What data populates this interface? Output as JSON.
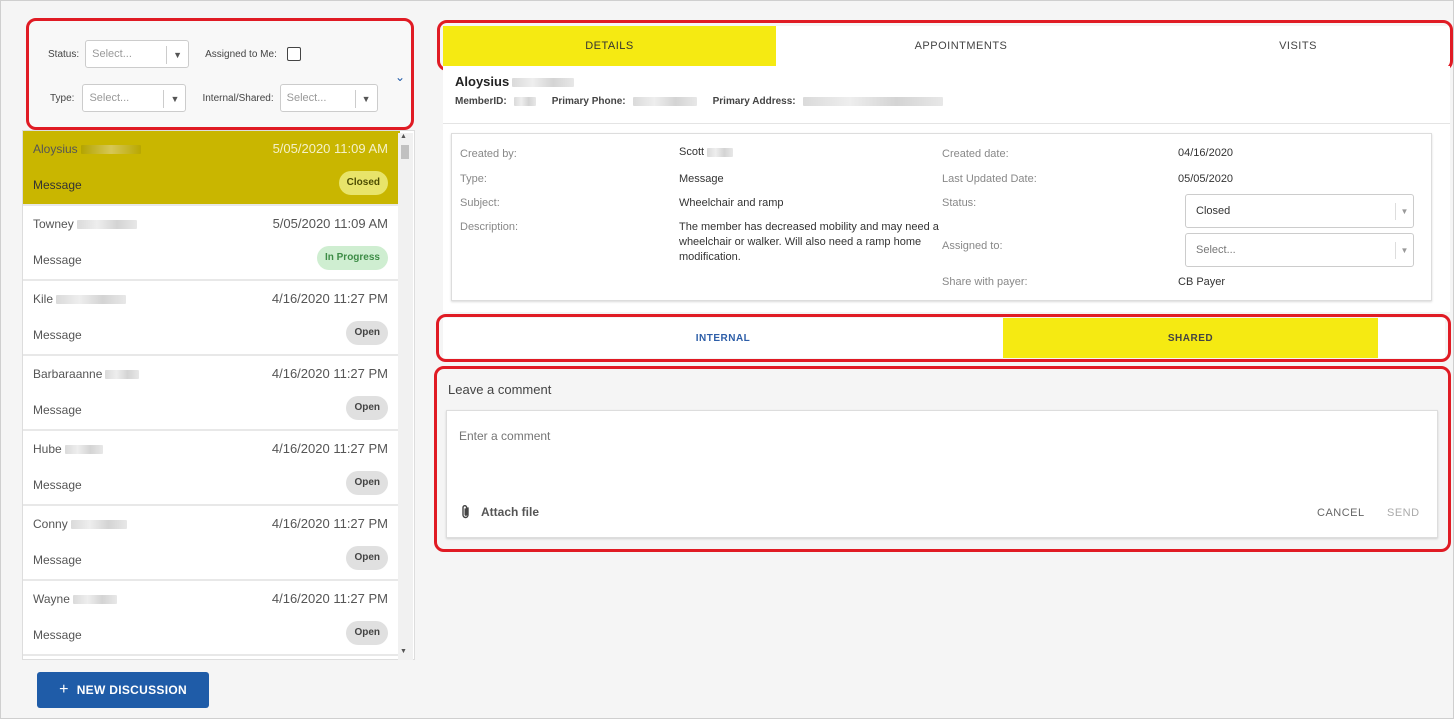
{
  "filters": {
    "status_label": "Status:",
    "status_placeholder": "Select...",
    "assigned_label": "Assigned to Me:",
    "type_label": "Type:",
    "type_placeholder": "Select...",
    "internal_label": "Internal/Shared:",
    "internal_placeholder": "Select..."
  },
  "discussions": [
    {
      "name": "Aloysius",
      "date": "5/05/2020 11:09 AM",
      "type": "Message",
      "status": "Closed"
    },
    {
      "name": "Towney",
      "date": "5/05/2020 11:09 AM",
      "type": "Message",
      "status": "In Progress"
    },
    {
      "name": "Kile",
      "date": "4/16/2020 11:27 PM",
      "type": "Message",
      "status": "Open"
    },
    {
      "name": "Barbaraanne",
      "date": "4/16/2020 11:27 PM",
      "type": "Message",
      "status": "Open"
    },
    {
      "name": "Hube",
      "date": "4/16/2020 11:27 PM",
      "type": "Message",
      "status": "Open"
    },
    {
      "name": "Conny",
      "date": "4/16/2020 11:27 PM",
      "type": "Message",
      "status": "Open"
    },
    {
      "name": "Wayne",
      "date": "4/16/2020 11:27 PM",
      "type": "Message",
      "status": "Open"
    }
  ],
  "new_discussion_label": "NEW DISCUSSION",
  "tabs": {
    "details": "DETAILS",
    "appointments": "APPOINTMENTS",
    "visits": "VISITS"
  },
  "member": {
    "name": "Aloysius",
    "member_id_label": "MemberID:",
    "phone_label": "Primary Phone:",
    "address_label": "Primary Address:"
  },
  "details": {
    "created_by_label": "Created by:",
    "created_by": "Scott",
    "type_label": "Type:",
    "type": "Message",
    "subject_label": "Subject:",
    "subject": "Wheelchair and ramp",
    "description_label": "Description:",
    "description": "The member has decreased mobility and may need a wheelchair or walker. Will also need a ramp home modification.",
    "created_date_label": "Created date:",
    "created_date": "04/16/2020",
    "updated_label": "Last Updated Date:",
    "updated_date": "05/05/2020",
    "status_label": "Status:",
    "status": "Closed",
    "assigned_label": "Assigned to:",
    "assigned": "Select...",
    "share_label": "Share with payer:",
    "share": "CB Payer"
  },
  "comment_tabs": {
    "internal": "INTERNAL",
    "shared": "SHARED"
  },
  "comment": {
    "heading": "Leave a comment",
    "placeholder": "Enter a comment",
    "attach": "Attach file",
    "cancel": "CANCEL",
    "send": "SEND"
  },
  "colors": {
    "highlight": "#f5ea12",
    "selected_row": "#c9b600",
    "primary": "#1f5ca8",
    "annotation": "#e01b24"
  }
}
